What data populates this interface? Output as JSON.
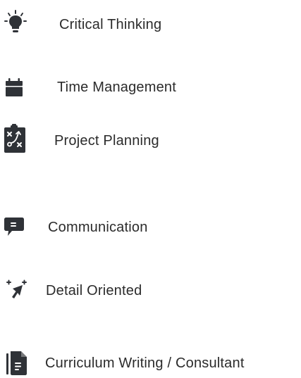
{
  "skills": [
    {
      "label": "Critical Thinking",
      "icon": "lightbulb-icon"
    },
    {
      "label": "Time Management",
      "icon": "calendar-icon"
    },
    {
      "label": "Project Planning",
      "icon": "clipboard-strategy-icon"
    },
    {
      "label": "Communication",
      "icon": "chat-bubble-icon"
    },
    {
      "label": "Detail Oriented",
      "icon": "cursor-arrow-icon"
    },
    {
      "label": "Curriculum Writing / Consultant",
      "icon": "document-icon"
    }
  ],
  "colors": {
    "icon": "#2f3237",
    "text": "#2b2b2b",
    "background": "#ffffff"
  }
}
